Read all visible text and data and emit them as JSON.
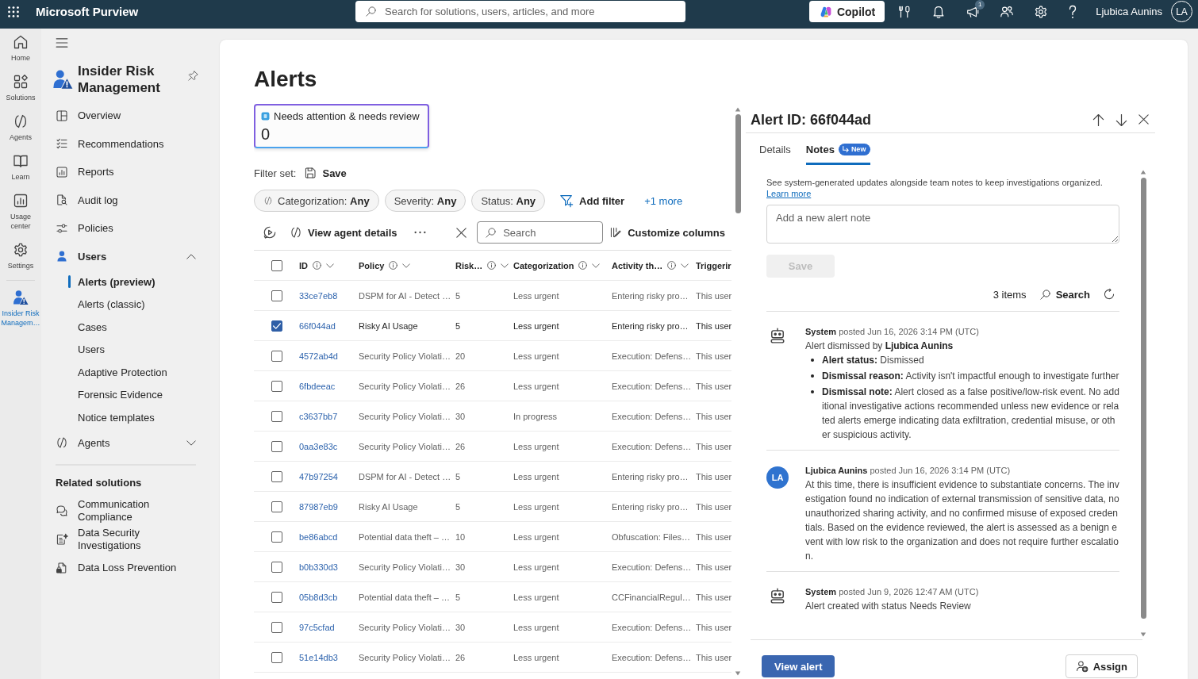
{
  "top_bar": {
    "app_name": "Microsoft Purview",
    "search": {
      "placeholder": "Search for solutions, users, articles, and more"
    },
    "copilot": "Copilot",
    "notification_count": "1",
    "user_name": "Ljubica Aunins",
    "initials": "LA"
  },
  "rail": {
    "items": [
      {
        "label": "Home",
        "selected": false
      },
      {
        "label": "Solutions",
        "selected": false
      },
      {
        "label": "Agents",
        "selected": false
      },
      {
        "label": "Learn",
        "selected": false
      },
      {
        "label": "Usage center",
        "selected": false
      },
      {
        "label": "Settings",
        "selected": false
      }
    ],
    "pinned": [
      {
        "label": "Insider Risk Managem…",
        "selected": true
      }
    ]
  },
  "sidebar": {
    "title": "Insider Risk Management",
    "items": [
      {
        "label": "Overview",
        "selected": false
      },
      {
        "label": "Recommendations",
        "selected": false
      },
      {
        "label": "Reports",
        "selected": false
      },
      {
        "label": "Audit log",
        "selected": false
      },
      {
        "label": "Policies",
        "selected": false
      },
      {
        "label": "Users",
        "selected": false,
        "expanded": true,
        "children": [
          {
            "label": "Alerts (preview)",
            "selected": true
          },
          {
            "label": "Alerts (classic)",
            "selected": false
          },
          {
            "label": "Cases",
            "selected": false
          },
          {
            "label": "Users",
            "selected": false
          },
          {
            "label": "Adaptive Protection",
            "selected": false
          },
          {
            "label": "Forensic Evidence",
            "selected": false
          },
          {
            "label": "Notice templates",
            "selected": false
          }
        ]
      },
      {
        "label": "Agents",
        "selected": false,
        "expanded": false
      }
    ],
    "related_heading": "Related solutions",
    "related": [
      "Communication Compliance",
      "Data Security Investigations",
      "Data Loss Prevention"
    ]
  },
  "alerts": {
    "title": "Alerts",
    "kpi_card": {
      "label": "Needs attention & needs review",
      "value": "0",
      "selected": true
    },
    "filter_set": {
      "label": "Filter set:",
      "save": "Save"
    },
    "filters": [
      {
        "kind": "icon",
        "name": "Categorization:",
        "value": "Any"
      },
      {
        "kind": "plain",
        "name": "Severity:",
        "value": "Any"
      },
      {
        "kind": "plain",
        "name": "Status:",
        "value": "Any"
      }
    ],
    "add_filter": "Add filter",
    "more_filters": "+1 more",
    "toolbar": {
      "view_agent_details": "View agent details",
      "search": {
        "placeholder": "Search"
      },
      "customize_columns": "Customize columns"
    },
    "table": {
      "select_all": {
        "checked": false
      },
      "columns": [
        {
          "label": "ID",
          "kind": "sortable"
        },
        {
          "label": "Policy",
          "kind": "sortable"
        },
        {
          "label": "Risk…",
          "kind": "sortable"
        },
        {
          "label": "Categorization",
          "kind": "sortable"
        },
        {
          "label": "Activity th…",
          "kind": "sortable"
        },
        {
          "label": "Triggerir",
          "kind": "clipped"
        }
      ],
      "rows": [
        {
          "selected": false,
          "id": "33ce7eb8",
          "policy": "DSPM for AI - Detect …",
          "risk": "5",
          "categorization": "Less urgent",
          "activity": "Entering risky pro…",
          "column_6": "This user"
        },
        {
          "selected": true,
          "id": "66f044ad",
          "policy": "Risky AI Usage",
          "risk": "5",
          "categorization": "Less urgent",
          "activity": "Entering risky pro…",
          "column_6": "This user"
        },
        {
          "selected": false,
          "id": "4572ab4d",
          "policy": "Security Policy Violati…",
          "risk": "20",
          "categorization": "Less urgent",
          "activity": "Execution: Defens…",
          "column_6": "This user"
        },
        {
          "selected": false,
          "id": "6fbdeeac",
          "policy": "Security Policy Violati…",
          "risk": "26",
          "categorization": "Less urgent",
          "activity": "Execution: Defens…",
          "column_6": "This user"
        },
        {
          "selected": false,
          "id": "c3637bb7",
          "policy": "Security Policy Violati…",
          "risk": "30",
          "categorization": "In progress",
          "activity": "Execution: Defens…",
          "column_6": "This user"
        },
        {
          "selected": false,
          "id": "0aa3e83c",
          "policy": "Security Policy Violati…",
          "risk": "26",
          "categorization": "Less urgent",
          "activity": "Execution: Defens…",
          "column_6": "This user"
        },
        {
          "selected": false,
          "id": "47b97254",
          "policy": "DSPM for AI - Detect …",
          "risk": "5",
          "categorization": "Less urgent",
          "activity": "Entering risky pro…",
          "column_6": "This user"
        },
        {
          "selected": false,
          "id": "87987eb9",
          "policy": "Risky AI Usage",
          "risk": "5",
          "categorization": "Less urgent",
          "activity": "Entering risky pro…",
          "column_6": "This user"
        },
        {
          "selected": false,
          "id": "be86abcd",
          "policy": "Potential data theft – …",
          "risk": "10",
          "categorization": "Less urgent",
          "activity": "Obfuscation: Files…",
          "column_6": "This user"
        },
        {
          "selected": false,
          "id": "b0b330d3",
          "policy": "Security Policy Violati…",
          "risk": "30",
          "categorization": "Less urgent",
          "activity": "Execution: Defens…",
          "column_6": "This user"
        },
        {
          "selected": false,
          "id": "05b8d3cb",
          "policy": "Potential data theft – …",
          "risk": "5",
          "categorization": "Less urgent",
          "activity": "CCFinancialRegul…",
          "column_6": "This user"
        },
        {
          "selected": false,
          "id": "97c5cfad",
          "policy": "Security Policy Violati…",
          "risk": "30",
          "categorization": "Less urgent",
          "activity": "Execution: Defens…",
          "column_6": "This user"
        },
        {
          "selected": false,
          "id": "51e14db3",
          "policy": "Security Policy Violati…",
          "risk": "26",
          "categorization": "Less urgent",
          "activity": "Execution: Defens…",
          "column_6": "This user"
        }
      ]
    }
  },
  "panel": {
    "title": "Alert ID: 66f044ad",
    "tabs": [
      {
        "label": "Details",
        "selected": false
      },
      {
        "label": "Notes",
        "selected": true,
        "badge": "New"
      }
    ],
    "description": "See system-generated updates alongside team notes to keep investigations organized.",
    "learn_more": "Learn more",
    "note_field": {
      "placeholder": "Add a new alert note"
    },
    "save_button": {
      "label": "Save",
      "disabled": true
    },
    "item_count": "3 items",
    "search": "Search",
    "notes": [
      {
        "kind": "system",
        "header": "**System** posted Jun 16, 2026 3:14 PM (UTC)",
        "text": "Alert dismissed by **Ljubica Aunins**",
        "details": [
          "**Alert status:** Dismissed",
          "**Dismissal reason:** Activity isn't impactful enough to investigate further",
          "**Dismissal note:** Alert closed as a false positive/low-risk event. No additional investigative actions recommended unless new evidence or related alerts emerge indicating data exfiltration, credential misuse, or other suspicious activity."
        ]
      },
      {
        "kind": "user",
        "initials": "LA",
        "header": "**Ljubica Aunins** posted Jun 16, 2026 3:14 PM (UTC)",
        "text": "At this time, there is insufficient evidence to substantiate concerns. The investigation found no indication of external transmission of sensitive data, no unauthorized sharing activity, and no confirmed misuse of exposed credentials. Based on the evidence reviewed, the alert is assessed as a benign event with low risk to the organization and does not require further escalation."
      },
      {
        "kind": "system",
        "header": "**System** posted Jun 9, 2026 12:47 AM (UTC)",
        "text": "Alert created with status Needs Review"
      }
    ],
    "view_alert": "View alert",
    "assign": "Assign"
  }
}
